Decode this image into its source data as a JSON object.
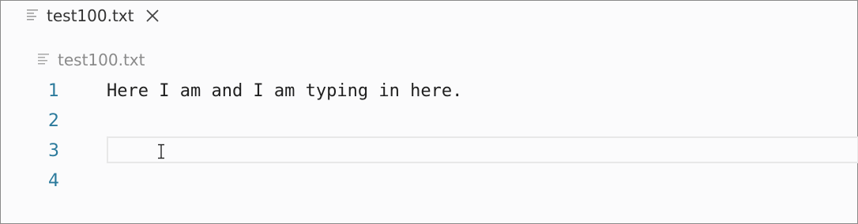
{
  "tab": {
    "title": "test100.txt",
    "file_icon": "text-file-icon",
    "close_icon": "close-icon"
  },
  "breadcrumb": {
    "file_label": "test100.txt",
    "file_icon": "text-file-icon"
  },
  "editor": {
    "lines": [
      {
        "number": "1",
        "text": "Here I am and I am typing in here."
      },
      {
        "number": "2",
        "text": ""
      },
      {
        "number": "3",
        "text": ""
      },
      {
        "number": "4",
        "text": ""
      }
    ],
    "current_line": 3,
    "cursor_icon": "i-beam-cursor-icon"
  },
  "colors": {
    "background": "#fbfbfc",
    "line_number": "#2b7a9c",
    "text": "#1f1f1f",
    "breadcrumb_text": "#8a8a8a",
    "current_line_border": "#e8e8e8"
  }
}
